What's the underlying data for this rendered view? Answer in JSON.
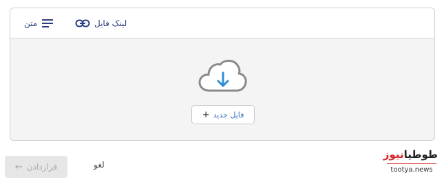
{
  "tabs": [
    {
      "label": "لینک فایل",
      "icon": "link-icon"
    },
    {
      "label": "متن",
      "icon": "text-lines-icon"
    }
  ],
  "dropzone": {
    "icon": "cloud-download-icon",
    "new_file_label": "فایل جدید",
    "new_file_plus": "+"
  },
  "footer": {
    "cancel_label": "لغو",
    "confirm_label": "قراردادن",
    "confirm_icon": "arrow-left-icon",
    "confirm_arrow": "←"
  },
  "watermark": {
    "brand_part1": "طوطیا",
    "brand_part2": "نیوز",
    "url": "tootya.news"
  },
  "colors": {
    "tab_text": "#2c3e80",
    "accent_blue": "#2d8fd5",
    "watermark_red": "#d8232a"
  }
}
